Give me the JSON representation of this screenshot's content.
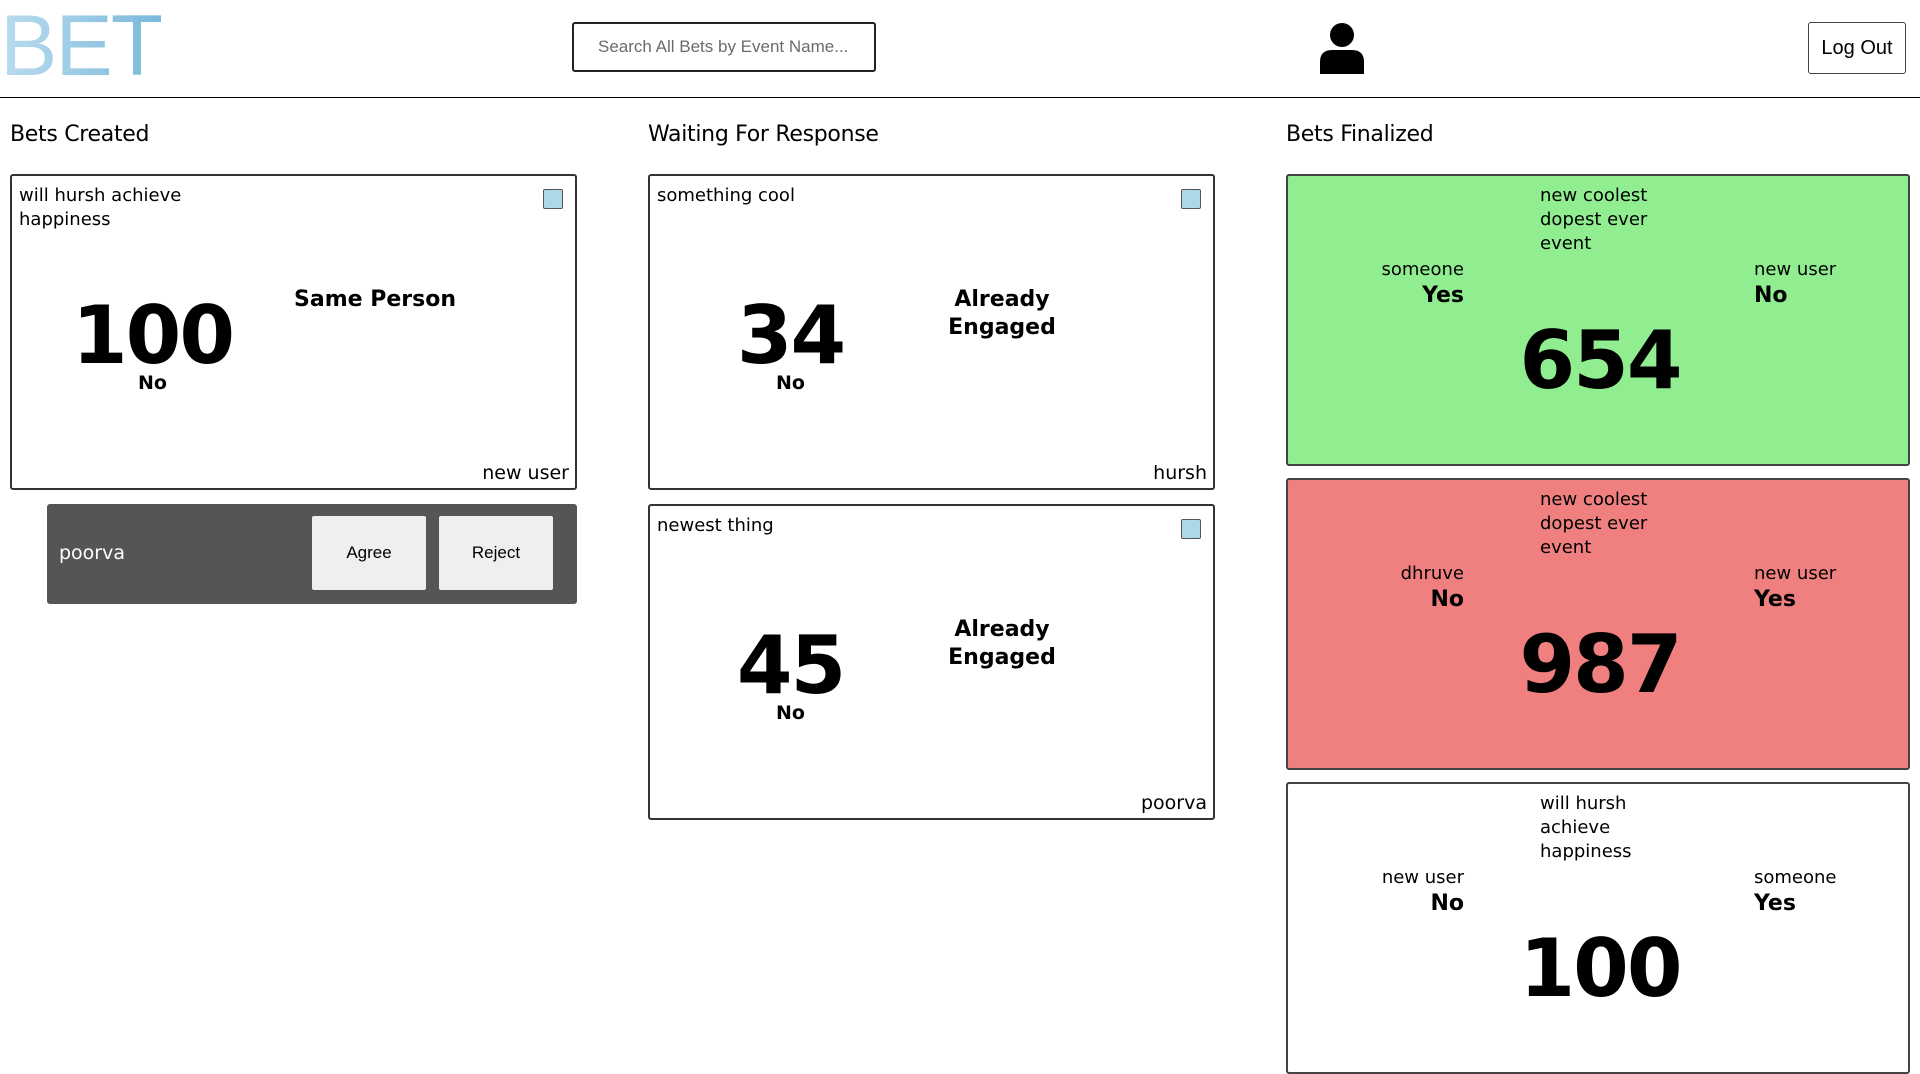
{
  "header": {
    "logo": "BET",
    "search_placeholder": "Search All Bets by Event Name...",
    "profile_icon": "user-icon",
    "logout_label": "Log Out"
  },
  "columns": {
    "created": {
      "title": "Bets Created",
      "cards": [
        {
          "event": "will hursh achieve happiness",
          "amount": "100",
          "pick": "No",
          "status": "Same Person",
          "user": "new user"
        }
      ],
      "request": {
        "user": "poorva",
        "agree_label": "Agree",
        "reject_label": "Reject"
      }
    },
    "waiting": {
      "title": "Waiting For Response",
      "cards": [
        {
          "event": "something cool",
          "amount": "34",
          "pick": "No",
          "status": "Already Engaged",
          "user": "hursh"
        },
        {
          "event": "newest thing",
          "amount": "45",
          "pick": "No",
          "status": "Already Engaged",
          "user": "poorva"
        }
      ]
    },
    "finalized": {
      "title": "Bets Finalized",
      "cards": [
        {
          "event": "new coolest dopest ever event",
          "left_user": "someone",
          "left_pick": "Yes",
          "right_user": "new user",
          "right_pick": "No",
          "amount": "654",
          "color": "#90ee90"
        },
        {
          "event": "new coolest dopest ever event",
          "left_user": "dhruve",
          "left_pick": "No",
          "right_user": "new user",
          "right_pick": "Yes",
          "amount": "987",
          "color": "#f08080"
        },
        {
          "event": "will hursh achieve happiness",
          "left_user": "new user",
          "left_pick": "No",
          "right_user": "someone",
          "right_pick": "Yes",
          "amount": "100",
          "color": "#ffffff"
        }
      ]
    }
  }
}
